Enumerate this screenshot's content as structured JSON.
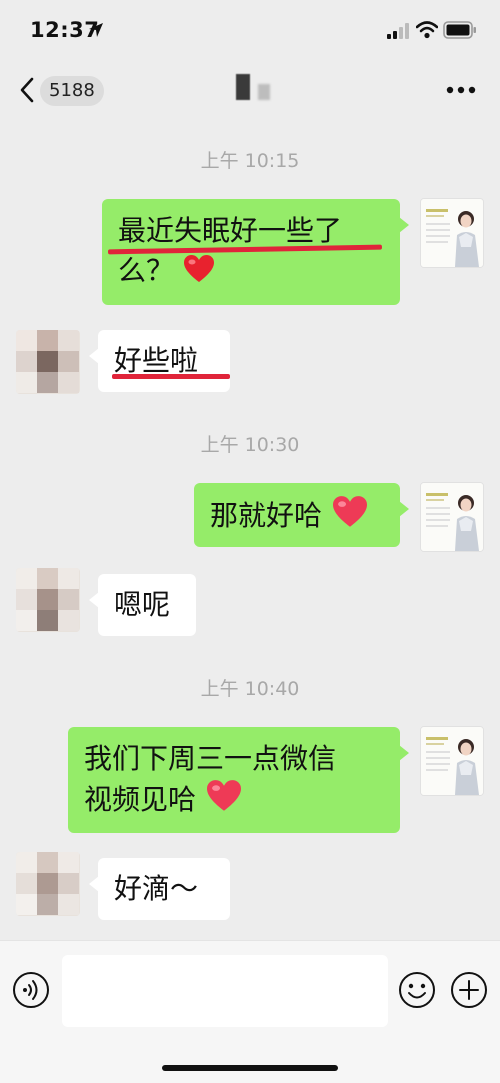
{
  "status_bar": {
    "time": "12:37",
    "icons": [
      "location-arrow-icon",
      "cellular-signal-icon",
      "wifi-icon",
      "battery-icon"
    ]
  },
  "nav_bar": {
    "back_icon": "chevron-left-icon",
    "unread_count": "5188",
    "more_icon": "more-dots-icon"
  },
  "messages": [
    {
      "type": "timestamp",
      "text": "上午 10:15"
    },
    {
      "type": "sent",
      "line1": "最近失眠好一些了",
      "line2": "么？",
      "emoji": "red-heart"
    },
    {
      "type": "received",
      "text": "好些啦"
    },
    {
      "type": "timestamp",
      "text": "上午 10:30"
    },
    {
      "type": "sent",
      "text": "那就好哈",
      "emoji": "heart"
    },
    {
      "type": "received",
      "text": "嗯呢"
    },
    {
      "type": "timestamp",
      "text": "上午 10:40"
    },
    {
      "type": "sent",
      "line1": "我们下周三一点微信",
      "line2": "视频见哈",
      "emoji": "heart"
    },
    {
      "type": "received",
      "text": "好滴～"
    }
  ],
  "input_bar": {
    "voice_icon": "voice-icon",
    "input_value": "",
    "emoji_icon": "emoji-icon",
    "plus_icon": "plus-icon"
  },
  "colors": {
    "background": "#ededed",
    "sent_bubble": "#95ec69",
    "received_bubble": "#ffffff",
    "annotation_underline": "#e0243a",
    "timestamp_text": "#a8a8a8"
  }
}
